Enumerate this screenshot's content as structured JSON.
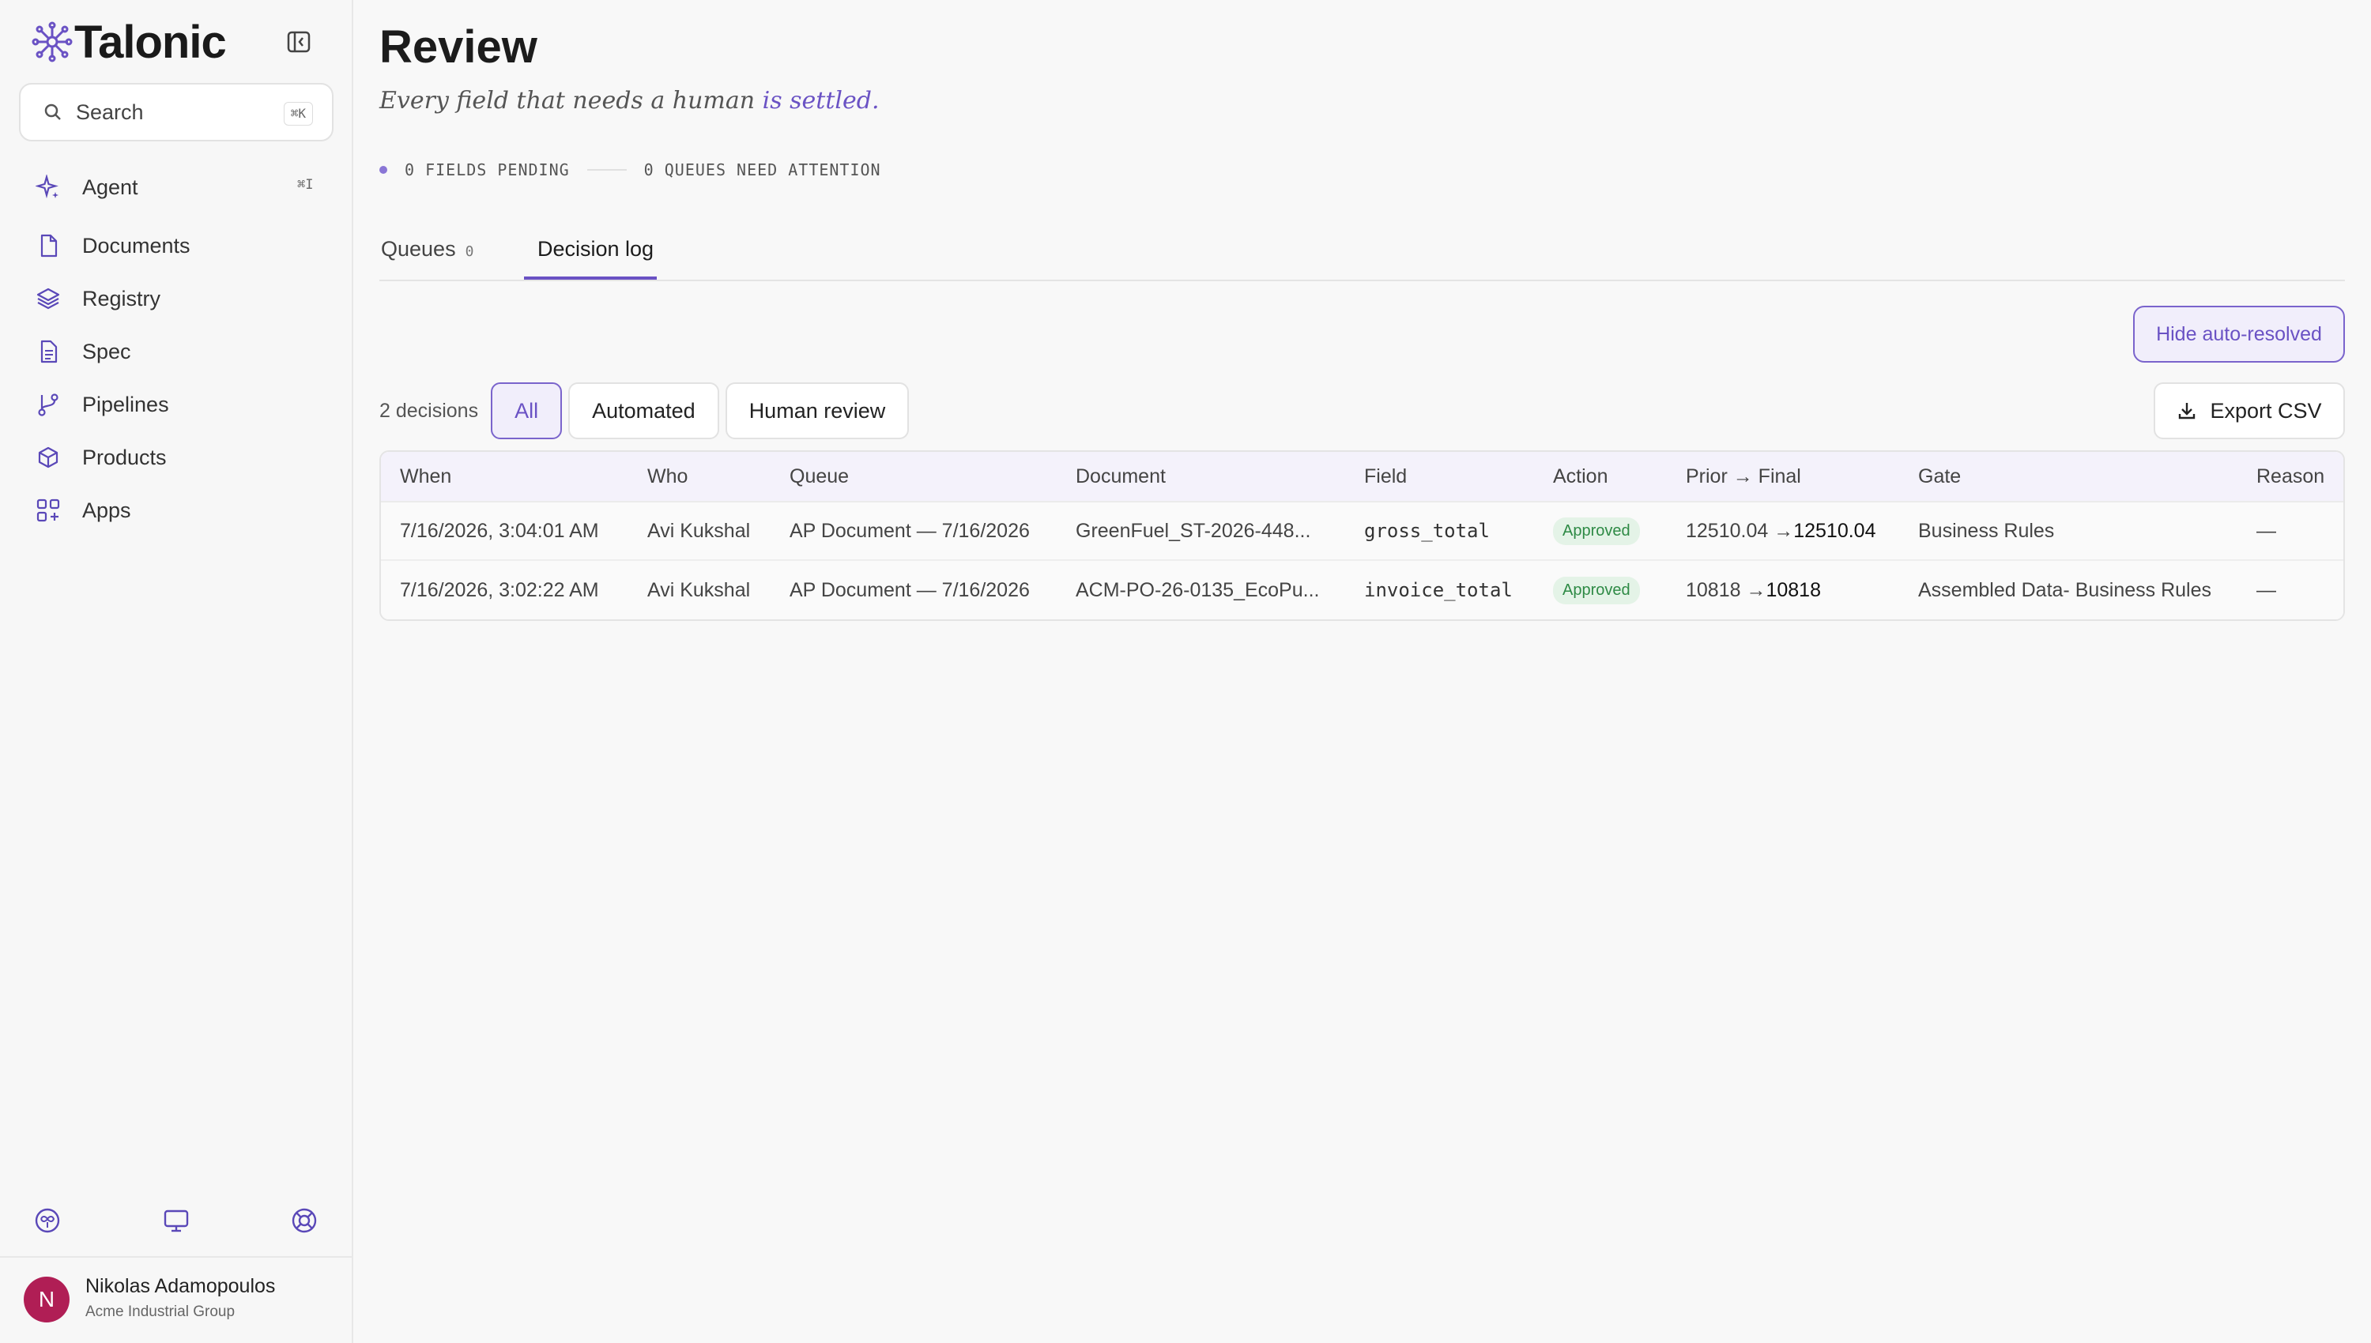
{
  "app": {
    "name": "Talonic"
  },
  "search": {
    "label": "Search",
    "shortcut": "⌘K"
  },
  "nav": {
    "agent_shortcut": "⌘I",
    "items": [
      {
        "label": "Agent",
        "icon": "sparkle-icon"
      },
      {
        "label": "Documents",
        "icon": "document-icon"
      },
      {
        "label": "Registry",
        "icon": "layers-icon"
      },
      {
        "label": "Spec",
        "icon": "file-text-icon"
      },
      {
        "label": "Pipelines",
        "icon": "git-branch-icon"
      },
      {
        "label": "Products",
        "icon": "box-icon"
      },
      {
        "label": "Apps",
        "icon": "grid-plus-icon"
      }
    ]
  },
  "user": {
    "initial": "N",
    "name": "Nikolas Adamopoulos",
    "org": "Acme Industrial Group"
  },
  "page": {
    "title": "Review",
    "subtitle_main": "Every field that needs a human ",
    "subtitle_accent": "is settled.",
    "fields_pending": "0 FIELDS PENDING",
    "queues_attention": "0 QUEUES NEED ATTENTION"
  },
  "tabs": [
    {
      "label": "Queues",
      "count": "0"
    },
    {
      "label": "Decision log"
    }
  ],
  "toolbar": {
    "hide_auto_resolved": "Hide auto-resolved",
    "decisions_count": "2 decisions",
    "filters": [
      "All",
      "Automated",
      "Human review"
    ],
    "export": "Export CSV"
  },
  "table": {
    "headers": [
      "When",
      "Who",
      "Queue",
      "Document",
      "Field",
      "Action",
      "Prior → Final",
      "Gate",
      "Reason"
    ],
    "rows": [
      {
        "when": "7/16/2026, 3:04:01 AM",
        "who": "Avi Kukshal",
        "queue": "AP Document — 7/16/2026",
        "document": "GreenFuel_ST-2026-448...",
        "field": "gross_total",
        "action": "Approved",
        "prior": "12510.04 → ",
        "final": "12510.04",
        "gate": "Business Rules",
        "reason": "—"
      },
      {
        "when": "7/16/2026, 3:02:22 AM",
        "who": "Avi Kukshal",
        "queue": "AP Document — 7/16/2026",
        "document": "ACM-PO-26-0135_EcoPu...",
        "field": "invoice_total",
        "action": "Approved",
        "prior": "10818 → ",
        "final": "10818",
        "gate": "Assembled Data- Business Rules",
        "reason": "—"
      }
    ]
  },
  "colors": {
    "accent": "#6a52c4",
    "approved_bg": "#e4f3e7",
    "approved_text": "#2e8a45",
    "avatar": "#b01e55"
  }
}
